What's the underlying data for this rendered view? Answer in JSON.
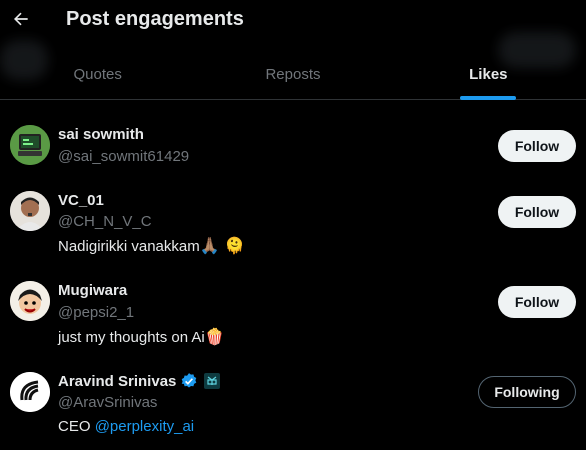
{
  "header": {
    "title": "Post engagements"
  },
  "tabs": [
    {
      "label": "Quotes",
      "active": false
    },
    {
      "label": "Reposts",
      "active": false
    },
    {
      "label": "Likes",
      "active": true
    }
  ],
  "colors": {
    "accent": "#1d9bf0",
    "muted": "#71767b",
    "text": "#e7e9ea",
    "background": "#000000",
    "verified": "#1d9bf0"
  },
  "users": [
    {
      "name": "sai sowmith",
      "handle": "@sai_sowmit61429",
      "bio": "",
      "button": "Follow"
    },
    {
      "name": "VC_01",
      "handle": "@CH_N_V_C",
      "bio": "Nadigirikki vanakkam",
      "bio_emoji": "🙏🏽 🫠",
      "button": "Follow"
    },
    {
      "name": "Mugiwara",
      "handle": "@pepsi2_1",
      "bio": "just my thoughts on Ai",
      "bio_emoji": "🍿",
      "button": "Follow"
    },
    {
      "name": "Aravind Srinivas",
      "handle": "@AravSrinivas",
      "bio_prefix": "CEO ",
      "bio_link": "@perplexity_ai",
      "button": "Following",
      "verified": true,
      "affiliate_badge": "perplexity-badge-icon"
    }
  ]
}
